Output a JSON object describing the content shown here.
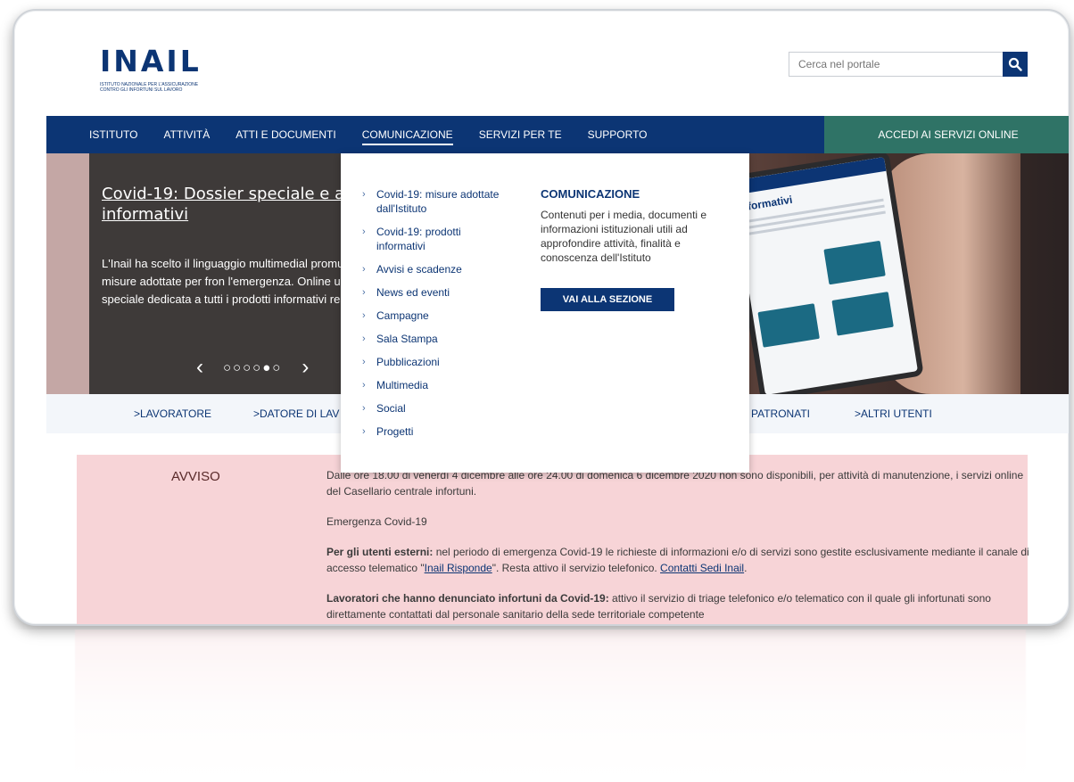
{
  "header": {
    "logo_text": "INAIL",
    "logo_subtitle": "ISTITUTO NAZIONALE PER L'ASSICURAZIONE CONTRO GLI INFORTUNI SUL LAVORO",
    "search_placeholder": "Cerca nel portale"
  },
  "nav": {
    "items": [
      {
        "label": "ISTITUTO"
      },
      {
        "label": "ATTIVITÀ"
      },
      {
        "label": "ATTI E DOCUMENTI"
      },
      {
        "label": "COMUNICAZIONE",
        "active": true
      },
      {
        "label": "SERVIZI PER TE"
      },
      {
        "label": "SUPPORTO"
      }
    ],
    "cta_label": "ACCEDI AI SERVIZI ONLINE"
  },
  "hero": {
    "title": "Covid-19: Dossier speciale e alt informativi",
    "text": "L'Inail ha scelto il linguaggio multimedial promuovere le misure adottate per fron l'emergenza. Online un dossier speciale dedicata a tutti i prodotti informativi rea",
    "prev_symbol": "‹",
    "next_symbol": "›",
    "dots": "○○○○●○",
    "tablet_title": "nformativi"
  },
  "dropdown": {
    "items": [
      {
        "label": "Covid-19: misure adottate dall'Istituto"
      },
      {
        "label": "Covid-19: prodotti informativi"
      },
      {
        "label": "Avvisi e scadenze"
      },
      {
        "label": "News ed eventi"
      },
      {
        "label": "Campagne"
      },
      {
        "label": "Sala Stampa"
      },
      {
        "label": "Pubblicazioni"
      },
      {
        "label": "Multimedia"
      },
      {
        "label": "Social"
      },
      {
        "label": "Progetti"
      }
    ],
    "section_title": "COMUNICAZIONE",
    "section_desc": "Contenuti per i media, documenti e informazioni istituzionali utili ad approfondire attività, finalità e conoscenza dell'Istituto",
    "section_button": "VAI ALLA SEZIONE"
  },
  "user_strip": {
    "items": [
      {
        "label": ">LAVORATORE"
      },
      {
        "label": ">DATORE DI LAV"
      },
      {
        "label": "PATRONATI"
      },
      {
        "label": ">ALTRI UTENTI"
      }
    ]
  },
  "notice": {
    "label": "AVVISO",
    "p1": "Dalle ore 18.00 di venerdì 4 dicembre alle ore 24.00 di domenica 6 dicembre 2020 non sono disponibili, per attività di manutenzione, i servizi online del Casellario centrale infortuni.",
    "p2": "Emergenza Covid-19",
    "p3_bold": "Per gli utenti esterni:",
    "p3_text": " nel periodo di emergenza Covid-19 le richieste di informazioni e/o di servizi sono gestite esclusivamente mediante il canale di accesso telematico \"",
    "p3_link1": "Inail Risponde",
    "p3_text2": "\". Resta attivo il servizio telefonico. ",
    "p3_link2": "Contatti Sedi Inail",
    "p3_end": ".",
    "p4_bold": "Lavoratori che hanno denunciato infortuni da Covid-19:",
    "p4_text": " attivo il servizio di triage telefonico e/o telematico con il quale gli infortunati sono direttamente contattati dal personale sanitario della sede territoriale competente"
  },
  "colors": {
    "brand_blue": "#0c3574",
    "cta_green": "#2f7366",
    "notice_pink": "#f7d4d7"
  }
}
